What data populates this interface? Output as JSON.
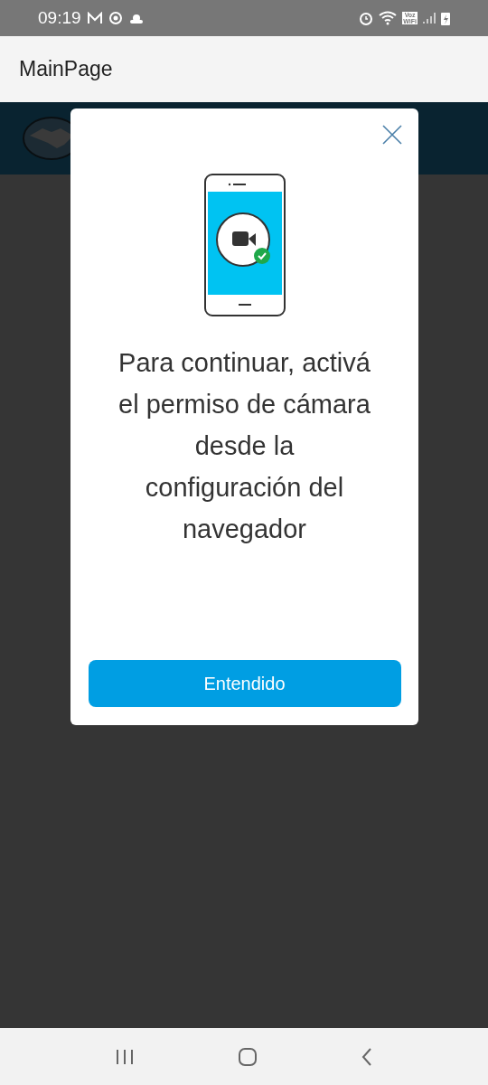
{
  "status_bar": {
    "time": "09:19",
    "voz_wifi": "Voz\nWiFi"
  },
  "app_bar": {
    "title": "MainPage"
  },
  "dialog": {
    "message_lines": [
      "Para continuar, activá",
      "el permiso de cámara",
      "desde la",
      "configuración del",
      "navegador"
    ],
    "button": "Entendido"
  }
}
